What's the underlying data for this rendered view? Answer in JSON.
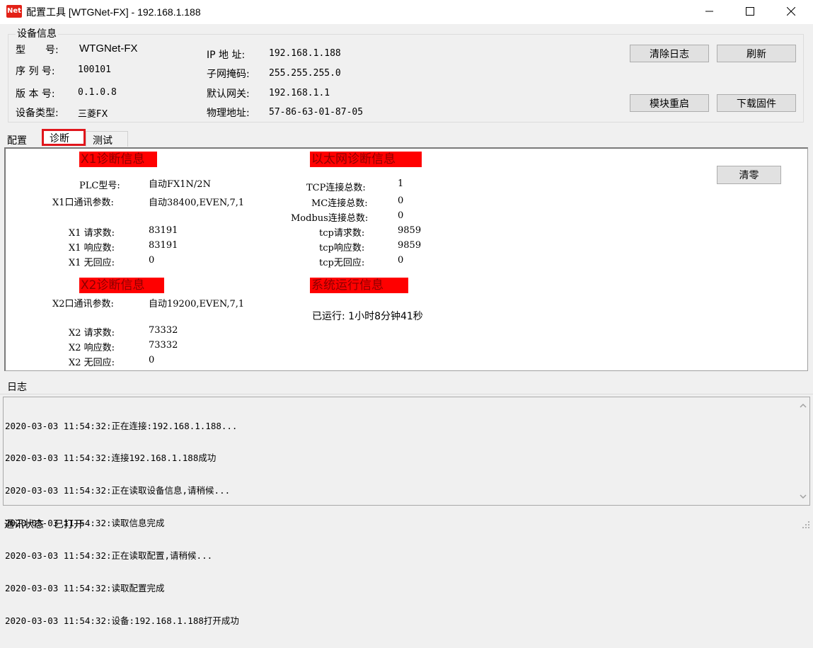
{
  "window": {
    "icon_text": "Net",
    "title": "配置工具 [WTGNet-FX] - 192.168.1.188"
  },
  "device_info": {
    "group_title": "设备信息",
    "model_label": "型　　号:",
    "model_value": "WTGNet-FX",
    "serial_label": "序 列 号:",
    "serial_value": "100101",
    "version_label": "版 本 号:",
    "version_value": "0.1.0.8",
    "type_label": "设备类型:",
    "type_value": "三菱FX",
    "ip_label": "IP 地 址:",
    "ip_value": "192.168.1.188",
    "mask_label": "子网掩码:",
    "mask_value": "255.255.255.0",
    "gateway_label": "默认网关:",
    "gateway_value": "192.168.1.1",
    "mac_label": "物理地址:",
    "mac_value": "57-86-63-01-87-05"
  },
  "buttons": {
    "clear_log": "清除日志",
    "refresh": "刷新",
    "restart": "模块重启",
    "download_firmware": "下载固件",
    "clear_zero": "清零"
  },
  "tabs": [
    "配置",
    "诊断",
    "测试"
  ],
  "diagnostics": {
    "x1_header": "X1诊断信息",
    "plc_model_label": "PLC型号:",
    "plc_model_value": "自动FX1N/2N",
    "x1_params_label": "X1口通讯参数:",
    "x1_params_value": "自动38400,EVEN,7,1",
    "x1_req_label": "X1 请求数:",
    "x1_req_value": "83191",
    "x1_resp_label": "X1 响应数:",
    "x1_resp_value": "83191",
    "x1_noresp_label": "X1 无回应:",
    "x1_noresp_value": "0",
    "x2_header": "X2诊断信息",
    "x2_params_label": "X2口通讯参数:",
    "x2_params_value": "自动19200,EVEN,7,1",
    "x2_req_label": "X2 请求数:",
    "x2_req_value": "73332",
    "x2_resp_label": "X2 响应数:",
    "x2_resp_value": "73332",
    "x2_noresp_label": "X2 无回应:",
    "x2_noresp_value": "0",
    "eth_header": "以太网诊断信息",
    "tcp_total_label": "TCP连接总数:",
    "tcp_total_value": "1",
    "mc_total_label": "MC连接总数:",
    "mc_total_value": "0",
    "modbus_total_label": "Modbus连接总数:",
    "modbus_total_value": "0",
    "tcp_req_label": "tcp请求数:",
    "tcp_req_value": "9859",
    "tcp_resp_label": "tcp响应数:",
    "tcp_resp_value": "9859",
    "tcp_noresp_label": "tcp无回应:",
    "tcp_noresp_value": "0",
    "sys_header": "系统运行信息",
    "uptime": "已运行: 1小时8分钟41秒"
  },
  "log": {
    "title": "日志",
    "lines": [
      "2020-03-03 11:54:32:正在连接:192.168.1.188...",
      "2020-03-03 11:54:32:连接192.168.1.188成功",
      "2020-03-03 11:54:32:正在读取设备信息,请稍候...",
      "2020-03-03 11:54:32:读取信息完成",
      "2020-03-03 11:54:32:正在读取配置,请稍候...",
      "2020-03-03 11:54:32:读取配置完成",
      "2020-03-03 11:54:32:设备:192.168.1.188打开成功"
    ]
  },
  "status": {
    "label": "通讯状态",
    "value": "已打开"
  },
  "colors": {
    "header_red": "#ff0000",
    "tab_highlight": "#e0161c"
  }
}
